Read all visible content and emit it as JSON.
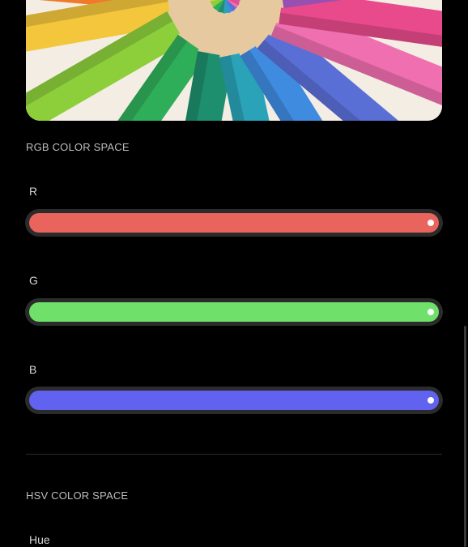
{
  "preview": {
    "alt": "colored pencils",
    "colors": [
      "#e8423b",
      "#f07a2a",
      "#f3c63b",
      "#8ccf3b",
      "#2fae5a",
      "#1e8f6e",
      "#2aa3b8",
      "#3f8be0",
      "#5a6fd6",
      "#f06fb0",
      "#e84a8c",
      "#b25fd0"
    ]
  },
  "rgb_section": {
    "title": "RGB COLOR SPACE",
    "channels": [
      {
        "label": "R",
        "value": 1.0,
        "color": "#e8645d"
      },
      {
        "label": "G",
        "value": 1.0,
        "color": "#6fe06a"
      },
      {
        "label": "B",
        "value": 1.0,
        "color": "#6262f0"
      }
    ]
  },
  "hsv_section": {
    "title": "HSV COLOR SPACE",
    "channels": [
      {
        "label": "Hue"
      }
    ]
  }
}
